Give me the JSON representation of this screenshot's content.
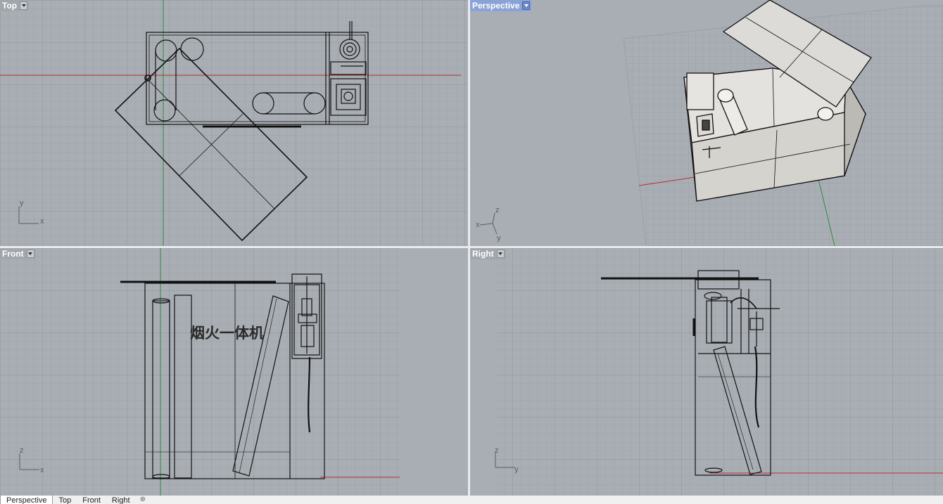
{
  "viewports": {
    "top": {
      "title": "Top",
      "axis_x": "x",
      "axis_y": "y"
    },
    "perspective": {
      "title": "Perspective",
      "axis_x": "x",
      "axis_y": "y",
      "axis_z": "z"
    },
    "front": {
      "title": "Front",
      "axis_x": "x",
      "axis_z": "z",
      "annotation": "烟火一体机"
    },
    "right": {
      "title": "Right",
      "axis_y": "y",
      "axis_z": "z"
    }
  },
  "tabs": [
    {
      "label": "Perspective"
    },
    {
      "label": "Top"
    },
    {
      "label": "Front"
    },
    {
      "label": "Right"
    }
  ],
  "tab_add_icon": "plus-icon",
  "active_viewport": "Perspective",
  "colors": {
    "viewport_bg": "#a9aeb4",
    "grid_minor": "#9ea3a9",
    "grid_major": "#8e9399",
    "x_axis": "#b4302c",
    "y_axis": "#2e8b3a",
    "active_label": "#8aa3d6",
    "model_stroke": "#111111",
    "shaded_surface": "#d2d0cb"
  }
}
